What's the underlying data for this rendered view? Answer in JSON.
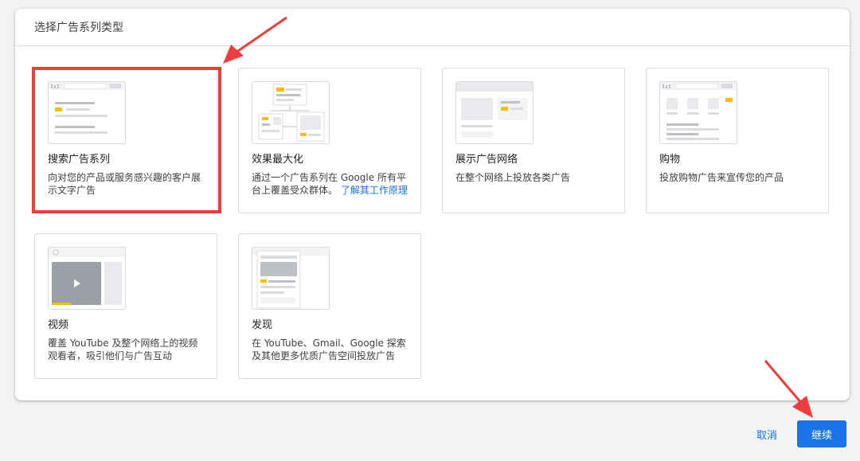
{
  "dialog": {
    "title": "选择广告系列类型"
  },
  "cards": [
    {
      "title": "搜索广告系列",
      "desc": "向对您的产品或服务感兴趣的客户展示文字广告",
      "thumb": "search-ad-illustration"
    },
    {
      "title": "效果最大化",
      "desc": "通过一个广告系列在 Google 所有平台上覆盖受众群体。",
      "link": "了解其工作原理",
      "thumb": "performance-max-illustration"
    },
    {
      "title": "展示广告网络",
      "desc": "在整个网络上投放各类广告",
      "thumb": "display-network-illustration"
    },
    {
      "title": "购物",
      "desc": "投放购物广告来宣传您的产品",
      "thumb": "shopping-illustration"
    },
    {
      "title": "视频",
      "desc": "覆盖 YouTube 及整个网络上的视频观看者，吸引他们与广告互动",
      "thumb": "video-illustration"
    },
    {
      "title": "发现",
      "desc": "在 YouTube、Gmail、Google 探索及其他更多优质广告空间投放广告",
      "thumb": "discovery-illustration"
    }
  ],
  "footer": {
    "cancel_label": "取消",
    "continue_label": "继续"
  },
  "colors": {
    "accent": "#1a73e8",
    "annotation": "#ef3c3c",
    "thumb_yellow": "#fbbc04"
  }
}
